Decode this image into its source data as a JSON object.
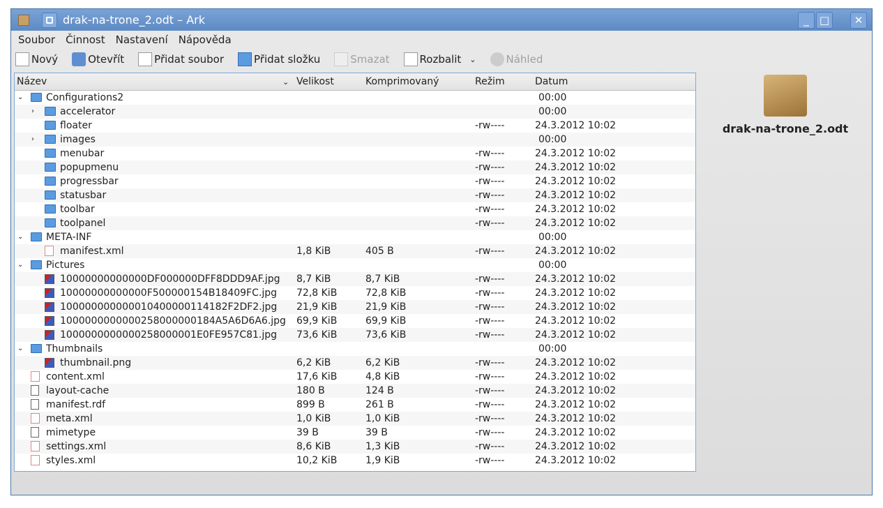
{
  "window": {
    "title": "drak-na-trone_2.odt – Ark",
    "minimize": "_",
    "maximize": "□",
    "close": "✕"
  },
  "menu": [
    "Soubor",
    "Činnost",
    "Nastavení",
    "Nápověda"
  ],
  "toolbar": [
    {
      "label": "Nový",
      "icon": "new-icon",
      "enabled": true
    },
    {
      "label": "Otevřít",
      "icon": "open-icon",
      "enabled": true
    },
    {
      "label": "Přidat soubor",
      "icon": "add-file-icon",
      "enabled": true
    },
    {
      "label": "Přidat složku",
      "icon": "add-folder-icon",
      "enabled": true
    },
    {
      "label": "Smazat",
      "icon": "delete-icon",
      "enabled": false
    },
    {
      "label": "Rozbalit",
      "icon": "extract-icon",
      "enabled": true,
      "dropdown": true
    },
    {
      "label": "Náhled",
      "icon": "preview-icon",
      "enabled": false
    }
  ],
  "columns": [
    "Název",
    "Velikost",
    "Komprimovaný",
    "Režim",
    "Datum"
  ],
  "rows": [
    {
      "name": "Configurations2",
      "level": 0,
      "type": "folder",
      "expand": "open",
      "size": "",
      "comp": "",
      "mode": "",
      "date": "00:00"
    },
    {
      "name": "accelerator",
      "level": 1,
      "type": "folder",
      "expand": "closed",
      "size": "",
      "comp": "",
      "mode": "",
      "date": "00:00"
    },
    {
      "name": "floater",
      "level": 1,
      "type": "folder",
      "size": "",
      "comp": "",
      "mode": "-rw----",
      "date": "24.3.2012 10:02"
    },
    {
      "name": "images",
      "level": 1,
      "type": "folder",
      "expand": "closed",
      "size": "",
      "comp": "",
      "mode": "",
      "date": "00:00"
    },
    {
      "name": "menubar",
      "level": 1,
      "type": "folder",
      "size": "",
      "comp": "",
      "mode": "-rw----",
      "date": "24.3.2012 10:02"
    },
    {
      "name": "popupmenu",
      "level": 1,
      "type": "folder",
      "size": "",
      "comp": "",
      "mode": "-rw----",
      "date": "24.3.2012 10:02"
    },
    {
      "name": "progressbar",
      "level": 1,
      "type": "folder",
      "size": "",
      "comp": "",
      "mode": "-rw----",
      "date": "24.3.2012 10:02"
    },
    {
      "name": "statusbar",
      "level": 1,
      "type": "folder",
      "size": "",
      "comp": "",
      "mode": "-rw----",
      "date": "24.3.2012 10:02"
    },
    {
      "name": "toolbar",
      "level": 1,
      "type": "folder",
      "size": "",
      "comp": "",
      "mode": "-rw----",
      "date": "24.3.2012 10:02"
    },
    {
      "name": "toolpanel",
      "level": 1,
      "type": "folder",
      "size": "",
      "comp": "",
      "mode": "-rw----",
      "date": "24.3.2012 10:02"
    },
    {
      "name": "META-INF",
      "level": 0,
      "type": "folder",
      "expand": "open",
      "size": "",
      "comp": "",
      "mode": "",
      "date": "00:00"
    },
    {
      "name": "manifest.xml",
      "level": 1,
      "type": "xml",
      "size": "1,8 KiB",
      "comp": "405 B",
      "mode": "-rw----",
      "date": "24.3.2012 10:02"
    },
    {
      "name": "Pictures",
      "level": 0,
      "type": "folder",
      "expand": "open",
      "size": "",
      "comp": "",
      "mode": "",
      "date": "00:00"
    },
    {
      "name": "10000000000000DF000000DFF8DDD9AF.jpg",
      "level": 1,
      "type": "img",
      "size": "8,7 KiB",
      "comp": "8,7 KiB",
      "mode": "-rw----",
      "date": "24.3.2012 10:02"
    },
    {
      "name": "10000000000000F500000154B18409FC.jpg",
      "level": 1,
      "type": "img",
      "size": "72,8 KiB",
      "comp": "72,8 KiB",
      "mode": "-rw----",
      "date": "24.3.2012 10:02"
    },
    {
      "name": "100000000000010400000114182F2DF2.jpg",
      "level": 1,
      "type": "img",
      "size": "21,9 KiB",
      "comp": "21,9 KiB",
      "mode": "-rw----",
      "date": "24.3.2012 10:02"
    },
    {
      "name": "1000000000000258000000184A5A6D6A6.jpg",
      "level": 1,
      "type": "img",
      "size": "69,9 KiB",
      "comp": "69,9 KiB",
      "mode": "-rw----",
      "date": "24.3.2012 10:02"
    },
    {
      "name": "1000000000000258000001E0FE957C81.jpg",
      "level": 1,
      "type": "img",
      "size": "73,6 KiB",
      "comp": "73,6 KiB",
      "mode": "-rw----",
      "date": "24.3.2012 10:02"
    },
    {
      "name": "Thumbnails",
      "level": 0,
      "type": "folder",
      "expand": "open",
      "size": "",
      "comp": "",
      "mode": "",
      "date": "00:00"
    },
    {
      "name": "thumbnail.png",
      "level": 1,
      "type": "img",
      "size": "6,2 KiB",
      "comp": "6,2 KiB",
      "mode": "-rw----",
      "date": "24.3.2012 10:02"
    },
    {
      "name": "content.xml",
      "level": 0,
      "type": "xml",
      "size": "17,6 KiB",
      "comp": "4,8 KiB",
      "mode": "-rw----",
      "date": "24.3.2012 10:02"
    },
    {
      "name": "layout-cache",
      "level": 0,
      "type": "gen",
      "size": "180 B",
      "comp": "124 B",
      "mode": "-rw----",
      "date": "24.3.2012 10:02"
    },
    {
      "name": "manifest.rdf",
      "level": 0,
      "type": "gen",
      "size": "899 B",
      "comp": "261 B",
      "mode": "-rw----",
      "date": "24.3.2012 10:02"
    },
    {
      "name": "meta.xml",
      "level": 0,
      "type": "xml",
      "size": "1,0 KiB",
      "comp": "1,0 KiB",
      "mode": "-rw----",
      "date": "24.3.2012 10:02"
    },
    {
      "name": "mimetype",
      "level": 0,
      "type": "gen",
      "size": "39 B",
      "comp": "39 B",
      "mode": "-rw----",
      "date": "24.3.2012 10:02"
    },
    {
      "name": "settings.xml",
      "level": 0,
      "type": "xml",
      "size": "8,6 KiB",
      "comp": "1,3 KiB",
      "mode": "-rw----",
      "date": "24.3.2012 10:02"
    },
    {
      "name": "styles.xml",
      "level": 0,
      "type": "xml",
      "size": "10,2 KiB",
      "comp": "1,9 KiB",
      "mode": "-rw----",
      "date": "24.3.2012 10:02"
    }
  ],
  "side": {
    "filename": "drak-na-trone_2.odt"
  }
}
